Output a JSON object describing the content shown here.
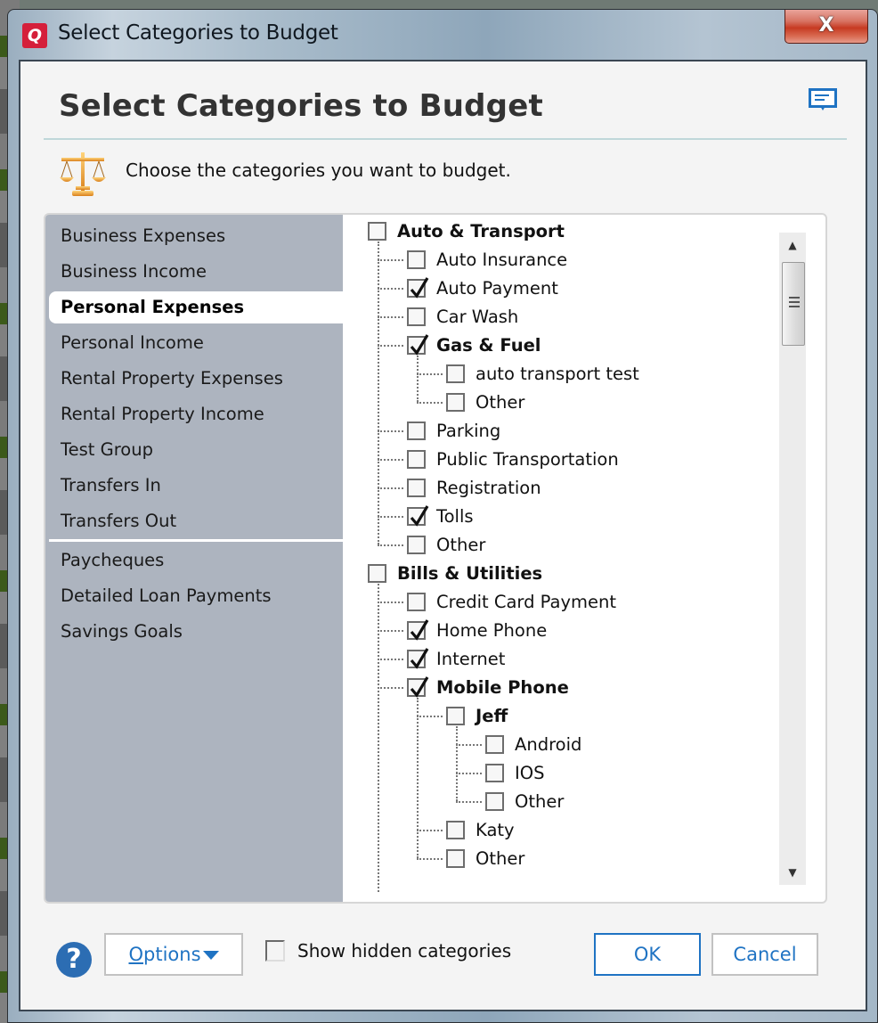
{
  "window": {
    "title": "Select Categories to Budget",
    "app_icon_letter": "Q",
    "close_glyph": "X"
  },
  "dialog": {
    "heading": "Select Categories to Budget",
    "instruction": "Choose the categories you want to budget."
  },
  "sidebar": {
    "items": [
      {
        "label": "Business Expenses",
        "selected": false
      },
      {
        "label": "Business Income",
        "selected": false
      },
      {
        "label": "Personal Expenses",
        "selected": true
      },
      {
        "label": "Personal Income",
        "selected": false
      },
      {
        "label": "Rental Property Expenses",
        "selected": false
      },
      {
        "label": "Rental Property Income",
        "selected": false
      },
      {
        "label": "Test Group",
        "selected": false
      },
      {
        "label": "Transfers In",
        "selected": false
      },
      {
        "label": "Transfers Out",
        "selected": false
      }
    ],
    "extra_items": [
      {
        "label": "Paycheques"
      },
      {
        "label": "Detailed Loan Payments"
      },
      {
        "label": "Savings Goals"
      }
    ]
  },
  "tree": {
    "rows": [
      {
        "label": "Auto & Transport",
        "level": 0,
        "checked": false,
        "bold": true
      },
      {
        "label": "Auto Insurance",
        "level": 1,
        "checked": false,
        "bold": false
      },
      {
        "label": "Auto Payment",
        "level": 1,
        "checked": true,
        "bold": false
      },
      {
        "label": "Car Wash",
        "level": 1,
        "checked": false,
        "bold": false
      },
      {
        "label": "Gas & Fuel",
        "level": 1,
        "checked": true,
        "bold": true
      },
      {
        "label": "auto transport test",
        "level": 2,
        "checked": false,
        "bold": false
      },
      {
        "label": "Other",
        "level": 2,
        "checked": false,
        "bold": false
      },
      {
        "label": "Parking",
        "level": 1,
        "checked": false,
        "bold": false
      },
      {
        "label": "Public Transportation",
        "level": 1,
        "checked": false,
        "bold": false
      },
      {
        "label": "Registration",
        "level": 1,
        "checked": false,
        "bold": false
      },
      {
        "label": "Tolls",
        "level": 1,
        "checked": true,
        "bold": false
      },
      {
        "label": "Other",
        "level": 1,
        "checked": false,
        "bold": false
      },
      {
        "label": "Bills & Utilities",
        "level": 0,
        "checked": false,
        "bold": true
      },
      {
        "label": "Credit Card Payment",
        "level": 1,
        "checked": false,
        "bold": false
      },
      {
        "label": "Home Phone",
        "level": 1,
        "checked": true,
        "bold": false
      },
      {
        "label": "Internet",
        "level": 1,
        "checked": true,
        "bold": false
      },
      {
        "label": "Mobile Phone",
        "level": 1,
        "checked": true,
        "bold": true
      },
      {
        "label": "Jeff",
        "level": 2,
        "checked": false,
        "bold": true
      },
      {
        "label": "Android",
        "level": 3,
        "checked": false,
        "bold": false
      },
      {
        "label": "IOS",
        "level": 3,
        "checked": false,
        "bold": false
      },
      {
        "label": "Other",
        "level": 3,
        "checked": false,
        "bold": false
      },
      {
        "label": "Katy",
        "level": 2,
        "checked": false,
        "bold": false
      },
      {
        "label": "Other",
        "level": 2,
        "checked": false,
        "bold": false
      }
    ]
  },
  "footer": {
    "help_glyph": "?",
    "options_label_first": "O",
    "options_label_rest": "ptions",
    "show_hidden_label": "Show hidden categories",
    "show_hidden_checked": false,
    "ok_label": "OK",
    "cancel_label": "Cancel"
  },
  "colors": {
    "accent": "#1f73c3",
    "sidebar_bg": "#adb4bf",
    "close_red": "#c73a22",
    "brand_red": "#d51f3a"
  }
}
